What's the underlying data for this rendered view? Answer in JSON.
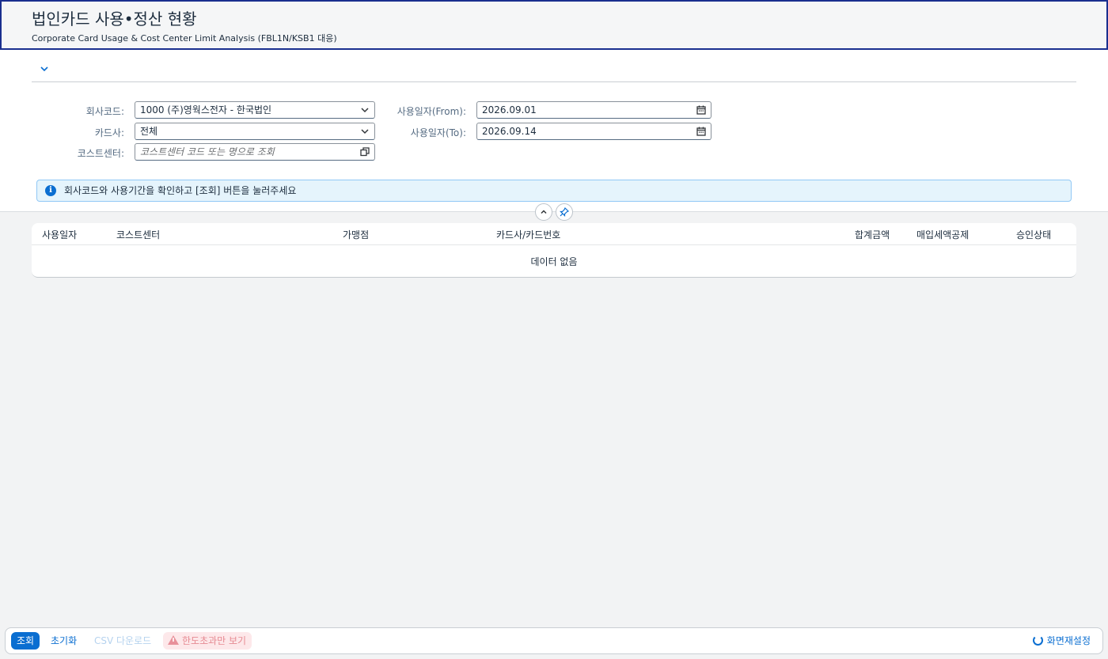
{
  "header": {
    "title": "법인카드 사용•정산 현황",
    "subtitle": "Corporate Card Usage & Cost Center Limit Analysis (FBL1N/KSB1 대응)"
  },
  "filters": {
    "company_code_label": "회사코드:",
    "company_code_value": "1000 (주)영웍스전자 - 한국법인",
    "card_company_label": "카드사:",
    "card_company_value": "전체",
    "cost_center_label": "코스트센터:",
    "cost_center_placeholder": "코스트센터 코드 또는 명으로 조회",
    "date_from_label": "사용일자(From):",
    "date_from_value": "2026.09.01",
    "date_to_label": "사용일자(To):",
    "date_to_value": "2026.09.14"
  },
  "info_message": "회사코드와 사용기간을 확인하고 [조회] 버튼을 눌러주세요",
  "table": {
    "columns": [
      "사용일자",
      "코스트센터",
      "가맹점",
      "카드사/카드번호",
      "합계금액",
      "매입세액공제",
      "승인상태"
    ],
    "empty_text": "데이터 없음"
  },
  "footer": {
    "search": "조회",
    "reset": "초기화",
    "csv": "CSV 다운로드",
    "over_limit": "한도초과만 보기",
    "screen_settings": "화면재설정"
  },
  "icons": {
    "collapse": "chevron-down-icon",
    "dropdown": "chevron-down-icon",
    "calendar": "calendar-icon",
    "value_help": "value-help-icon",
    "info": "info-icon",
    "collapse_header": "chevron-up-icon",
    "pin": "pin-icon",
    "warning": "warning-icon",
    "refresh": "refresh-icon"
  },
  "colors": {
    "accent": "#0a6ed1",
    "header_border": "#1a2f8f",
    "info_bg": "#e5f4fc",
    "warning_bg": "#fde8ea"
  }
}
